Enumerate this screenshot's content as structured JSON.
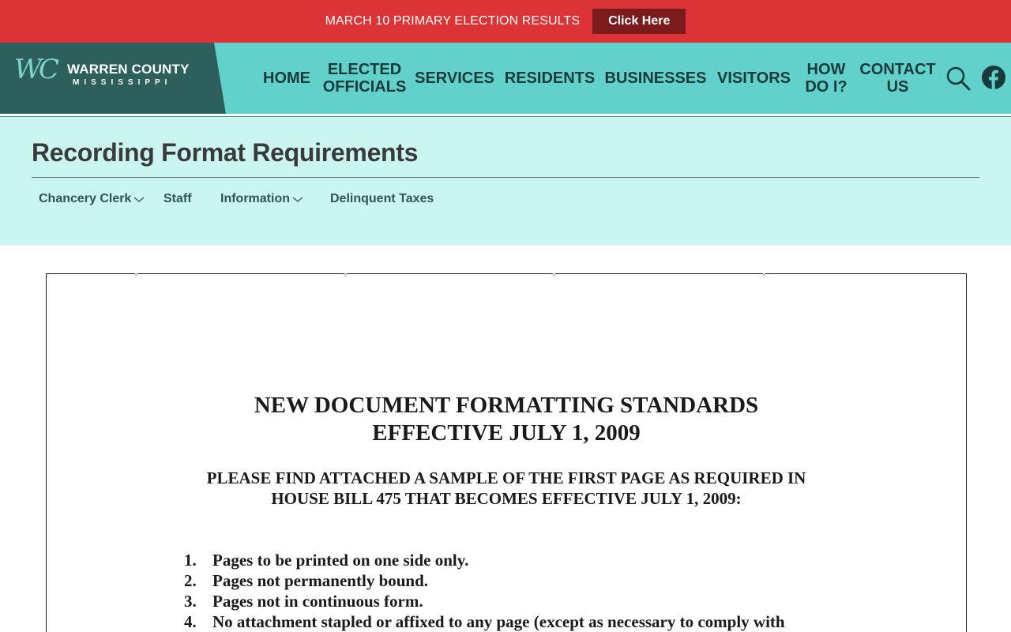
{
  "alert": {
    "text": "MARCH 10 PRIMARY ELECTION RESULTS",
    "button_label": "Click Here",
    "bar_color": "#dc3336",
    "button_color": "#7b1b1c"
  },
  "logo": {
    "monogram": "WC",
    "title": "WARREN COUNTY",
    "subtitle": "MISSISSIPPI"
  },
  "nav": {
    "home": "HOME",
    "elected_line1": "ELECTED",
    "elected_line2": "OFFICIALS",
    "services": "SERVICES",
    "residents": "RESIDENTS",
    "businesses": "BUSINESSES",
    "visitors": "VISITORS",
    "howdoi_line1": "HOW",
    "howdoi_line2": "DO I?",
    "contact_line1": "CONTACT",
    "contact_line2": "US",
    "icons": [
      "search-icon",
      "facebook-icon"
    ]
  },
  "page": {
    "title": "Recording Format Requirements",
    "subnav": [
      "Chancery Clerk",
      "Staff",
      "Information",
      "Delinquent Taxes"
    ]
  },
  "document": {
    "heading1": "NEW DOCUMENT FORMATTING STANDARDS",
    "heading2": "EFFECTIVE JULY 1, 2009",
    "para1": "PLEASE FIND ATTACHED A SAMPLE OF THE FIRST PAGE AS REQUIRED IN",
    "para2": "HOUSE BILL 475 THAT BECOMES EFFECTIVE JULY 1, 2009:",
    "items": [
      {
        "num": "1.",
        "text": "Pages to be printed on one side only."
      },
      {
        "num": "2.",
        "text": "Pages not permanently bound."
      },
      {
        "num": "3.",
        "text": "Pages not in continuous form."
      },
      {
        "num": "4.",
        "text": "No attachment stapled or affixed to any page (except as necessary to comply with"
      }
    ]
  },
  "colors": {
    "header_bg": "#62d0cb",
    "logo_bg": "#2d5f5c",
    "title_band_bg": "#cbf5f1"
  }
}
